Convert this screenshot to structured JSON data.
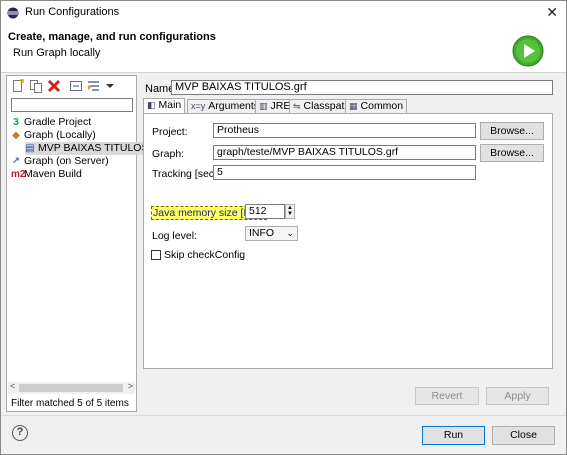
{
  "window": {
    "title": "Run Configurations",
    "close_glyph": "✕"
  },
  "header": {
    "title": "Create, manage, and run configurations",
    "subtitle": "Run Graph locally",
    "icon": "run-green-play-icon"
  },
  "left": {
    "toolbar_icons": [
      "new-config-icon",
      "duplicate-icon",
      "delete-icon",
      "collapse-all-icon",
      "filter-icon",
      "chevron-down-icon"
    ],
    "filter_value": "",
    "tree": [
      {
        "icon_glyph": "3",
        "icon": "gradle-icon",
        "label": "Gradle Project",
        "indent": 0,
        "selected": false
      },
      {
        "icon_glyph": "◆",
        "icon": "graph-icon",
        "label": "Graph (Locally)",
        "indent": 0,
        "selected": false
      },
      {
        "icon_glyph": "▤",
        "icon": "graph-file-icon",
        "label": "MVP BAIXAS TITULOS.grf",
        "indent": 1,
        "selected": true
      },
      {
        "icon_glyph": "↗",
        "icon": "graph-server-icon",
        "label": "Graph (on Server)",
        "indent": 0,
        "selected": false
      },
      {
        "icon_glyph": "m2",
        "icon": "maven-icon",
        "label": "Maven Build",
        "indent": 0,
        "selected": false
      }
    ],
    "filter_status": "Filter matched 5 of 5 items"
  },
  "config": {
    "name_label": "Name:",
    "name_value": "MVP BAIXAS TITULOS.grf",
    "tabs": [
      {
        "label": "Main",
        "icon_glyph": "◧",
        "active": true
      },
      {
        "label": "Arguments",
        "icon_glyph": "x=y",
        "active": false
      },
      {
        "label": "JRE",
        "icon_glyph": "▥",
        "active": false
      },
      {
        "label": "Classpath",
        "icon_glyph": "⇋",
        "active": false
      },
      {
        "label": "Common",
        "icon_glyph": "▦",
        "active": false
      }
    ],
    "main": {
      "project_label": "Project:",
      "project_value": "Protheus",
      "browse1": "Browse...",
      "graph_label": "Graph:",
      "graph_value": "graph/teste/MVP BAIXAS TITULOS.grf",
      "browse2": "Browse...",
      "tracking_label": "Tracking [secs]:",
      "tracking_value": "5",
      "memory_label": "Java memory size [MB]:",
      "memory_value": "512",
      "loglevel_label": "Log level:",
      "loglevel_value": "INFO",
      "skip_label": "Skip checkConfig",
      "skip_checked": false
    },
    "revert": "Revert",
    "apply": "Apply"
  },
  "footer": {
    "help_glyph": "?",
    "run": "Run",
    "close": "Close"
  }
}
